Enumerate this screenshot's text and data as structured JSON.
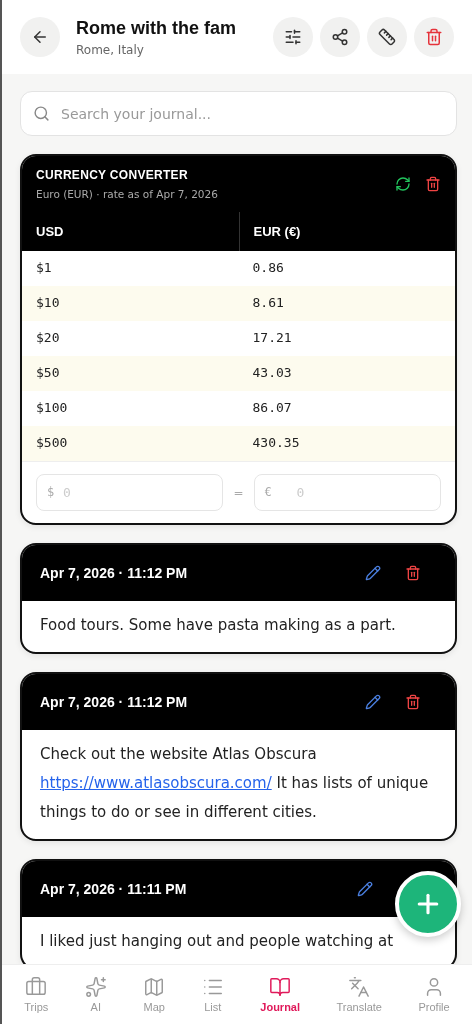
{
  "header": {
    "title": "Rome with the fam",
    "subtitle": "Rome, Italy"
  },
  "search": {
    "placeholder": "Search your journal..."
  },
  "converter": {
    "title": "CURRENCY CONVERTER",
    "subtitle": "Euro (EUR) · rate as of Apr 7, 2026",
    "columns": [
      "USD",
      "EUR (€)"
    ],
    "rows": [
      [
        "$1",
        "0.86"
      ],
      [
        "$10",
        "8.61"
      ],
      [
        "$20",
        "17.21"
      ],
      [
        "$50",
        "43.03"
      ],
      [
        "$100",
        "86.07"
      ],
      [
        "$500",
        "430.35"
      ]
    ],
    "from": {
      "symbol": "$",
      "placeholder": "0"
    },
    "equals": "=",
    "to": {
      "symbol": "€",
      "placeholder": "0"
    }
  },
  "entries": [
    {
      "date": "Apr 7, 2026",
      "separator": "·",
      "time": "11:12 PM",
      "parts": [
        {
          "kind": "text",
          "text": "Food tours. Some have pasta making as a part."
        }
      ]
    },
    {
      "date": "Apr 7, 2026",
      "separator": "·",
      "time": "11:12 PM",
      "parts": [
        {
          "kind": "text",
          "text": "Check out the website Atlas Obscura "
        },
        {
          "kind": "link",
          "text": "https://www.atlasobscura.com/"
        },
        {
          "kind": "text",
          "text": " It has lists of unique things to do or see in different cities."
        }
      ]
    },
    {
      "date": "Apr 7, 2026",
      "separator": "·",
      "time": "11:11 PM",
      "parts": [
        {
          "kind": "text",
          "text": "I liked just hanging out and people watching at"
        }
      ]
    }
  ],
  "nav": [
    {
      "label": "Trips",
      "selected": false
    },
    {
      "label": "AI",
      "selected": false
    },
    {
      "label": "Map",
      "selected": false
    },
    {
      "label": "List",
      "selected": false
    },
    {
      "label": "Journal",
      "selected": true
    },
    {
      "label": "Translate",
      "selected": false
    },
    {
      "label": "Profile",
      "selected": false
    }
  ]
}
